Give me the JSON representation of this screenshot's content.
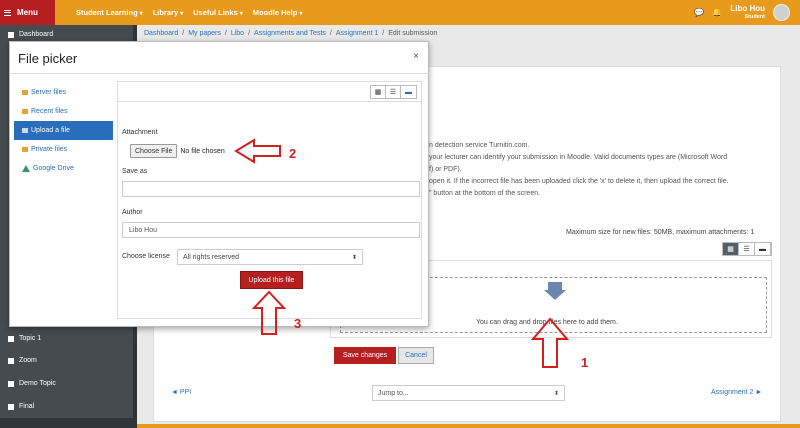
{
  "topbar": {
    "menu_label": "Menu",
    "nav": [
      "Student Learning",
      "Library",
      "Useful Links",
      "Moodle Help"
    ],
    "user_name": "Libo Hou",
    "user_role": "Student"
  },
  "drawer": {
    "items": [
      {
        "label": "Dashboard"
      },
      {
        "label": "Topic 1"
      },
      {
        "label": "Zoom"
      },
      {
        "label": "Demo Topic"
      },
      {
        "label": "Final"
      }
    ]
  },
  "breadcrumb": {
    "items": [
      "Dashboard",
      "My papers",
      "Libo",
      "Assignments and Tests",
      "Assignment 1"
    ],
    "current": "Edit submission"
  },
  "submission": {
    "line1": "n detection service Turnitin.com.",
    "line2": "your lecturer can identify your submission in Moodle. Valid documents types are (Microsoft Word",
    "line3": "f) or PDF).",
    "line4": "open it. If the incorrect file has been uploaded click the 'x' to delete it, then upload the correct file.",
    "line5": "\" button at the bottom of the screen.",
    "max_size": "Maximum size for new files: 50MB, maximum attachments: 1",
    "drop_text": "You can drag and drop files here to add them.",
    "save_label": "Save changes",
    "cancel_label": "Cancel",
    "prev_label": "◄ PPI",
    "jump_label": "Jump to...",
    "next_label": "Assignment 2 ►"
  },
  "file_picker": {
    "title": "File picker",
    "close": "×",
    "repositories": [
      {
        "label": "Server files",
        "active": false
      },
      {
        "label": "Recent files",
        "active": false
      },
      {
        "label": "Upload a file",
        "active": true
      },
      {
        "label": "Private files",
        "active": false
      },
      {
        "label": "Google Drive",
        "active": false
      }
    ],
    "attachment_label": "Attachment",
    "choose_file_label": "Choose File",
    "no_file_text": "No file chosen",
    "save_as_label": "Save as",
    "save_as_value": "",
    "author_label": "Author",
    "author_value": "Libo Hou",
    "license_label": "Choose license",
    "license_value": "All rights reserved",
    "upload_label": "Upload this file"
  },
  "annotations": {
    "one": "1",
    "two": "2",
    "three": "3"
  },
  "colors": {
    "topbar": "#e89a1d",
    "menu": "#b51f1f",
    "drawer": "#454b4f",
    "link": "#2a6ebb",
    "annotation": "#d42020"
  }
}
